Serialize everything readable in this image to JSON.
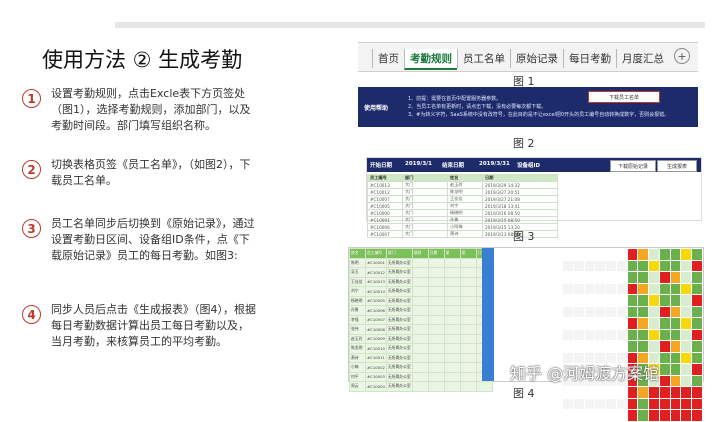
{
  "title": "使用方法 ② 生成考勤",
  "steps": [
    {
      "num": "1",
      "text": "设置考勤规则，点击Excle表下方页签处（图1），选择考勤规则，添加部门，以及考勤时间段。部门填写组织名称。"
    },
    {
      "num": "2",
      "text": "切换表格页签《员工名单》，（如图2），下载员工名单。"
    },
    {
      "num": "3",
      "text": "员工名单同步后切换到《原始记录》，通过设置考勤日区间、设备组ID条件，点《下载原始记录》员工的每日考勤。如图3:"
    },
    {
      "num": "4",
      "text": "同步人员后点击《生成报表》（图4），根据每日考勤数据计算出员工每日考勤以及，当月考勤，来核算员工的平均考勤。"
    }
  ],
  "fig1": {
    "tabs": [
      "首页",
      "考勤规则",
      "员工名单",
      "原始记录",
      "每日考勤",
      "月度汇总"
    ],
    "active_tab": "考勤规则",
    "caption": "图 1"
  },
  "fig2": {
    "label": "使用帮助",
    "notes": [
      "1、前提：需要在首页中配置服务器参数。",
      "2、当员工名单有更新时，请点击下载，没有必要每次都下载。",
      "3、#为转义字符，SaaS系统中没有改符号，在此目的是不让excel把0开头的员工编号自动转换成数字，否则会报错。"
    ],
    "button": "下载员工名单",
    "caption": "图 2"
  },
  "fig3": {
    "start_label": "开始日期",
    "start_value": "2019/3/1",
    "end_label": "结束日期",
    "end_value": "2019/3/31",
    "device_label": "设备组ID",
    "btn_download": "下载原始记录",
    "btn_report": "生成报表",
    "headers": [
      "员工编号",
      "部门",
      "姓名",
      "日期"
    ],
    "rows": [
      [
        "#C10013",
        "大门",
        "赵玉玲",
        "2019/3/29 14:32"
      ],
      [
        "#C10012",
        "大门",
        "陈龙明",
        "2019/3/27 20:51"
      ],
      [
        "#C10007",
        "大门",
        "王佳佳",
        "2019/3/27 21:08"
      ],
      [
        "#C10005",
        "大门",
        "刘宁",
        "2019/3/18 13:41"
      ],
      [
        "#C10000",
        "大门",
        "杨晓明",
        "2019/3/16 08:50"
      ],
      [
        "#C10001",
        "大门",
        "孙勇",
        "2019/3/15 08:50"
      ],
      [
        "#C10006",
        "大门",
        "小阿梅",
        "2019/3/15 13:20"
      ],
      [
        "#C10007",
        "大门",
        "萧诗",
        "2019/3/13 08:50"
      ]
    ],
    "caption": "图 3"
  },
  "fig4": {
    "headers": [
      "姓名",
      "员工编号",
      "部门",
      "规则",
      "日期",
      "星",
      "班",
      "打卡"
    ],
    "names": [
      "陈明",
      "吴玉",
      "王佳佳",
      "刘宁",
      "杨晓明",
      "孙勇",
      "李强",
      "张伟",
      "赵玉玲",
      "陈龙明",
      "萧诗",
      "小梅",
      "何平",
      "周云"
    ],
    "ids": [
      "#C10001",
      "#C10012",
      "#C10013",
      "#C10014",
      "#C10005",
      "#C10006",
      "#C10007",
      "#C10008",
      "#C10009",
      "#C10010",
      "#C10011",
      "#C10002",
      "#C10003",
      "#C10004"
    ],
    "dept": "无所属办公室",
    "caption": "图 4"
  },
  "watermark": "知乎 @河姆渡方案馆",
  "colors": {
    "accent_red": "#c0392b",
    "dark_blue": "#1d2b6b",
    "green": "#6ab04c",
    "light_green": "#d8eccf",
    "red": "#e02020",
    "orange": "#f5a623",
    "yellow": "#f5d90a",
    "blue": "#3b7fd3"
  }
}
